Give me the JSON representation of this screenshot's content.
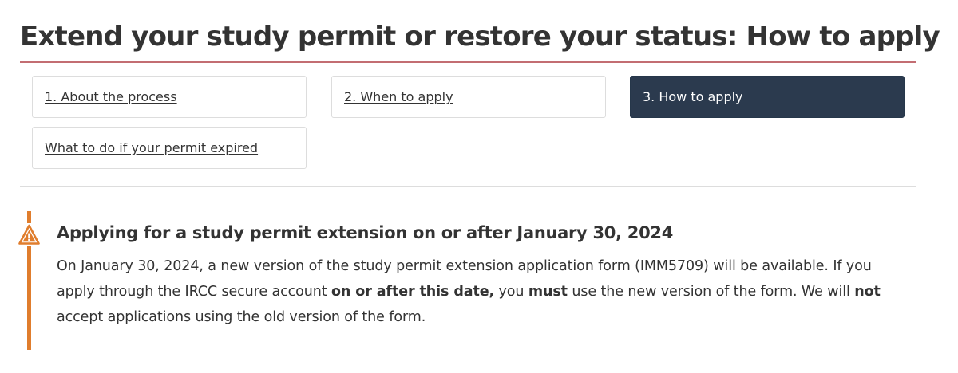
{
  "page": {
    "title": "Extend your study permit or restore your status: How to apply"
  },
  "steps": [
    {
      "label": "1. About the process",
      "active": false
    },
    {
      "label": "2. When to apply",
      "active": false
    },
    {
      "label": "3. How to apply",
      "active": true
    },
    {
      "label": "What to do if your permit expired",
      "active": false
    }
  ],
  "alert": {
    "type": "warning",
    "icon": "warning-triangle-icon",
    "accent_color": "#e07d2d",
    "heading": "Applying for a study permit extension on or after January 30, 2024",
    "body": {
      "line1": "On January 30, 2024, a new version of the study permit extension application form (IMM5709) will be available. If you",
      "line2_a": "apply through the IRCC secure account ",
      "line2_b": "on or after this date,",
      "line2_c": " you ",
      "line2_d": "must",
      "line2_e": " use the new version of the form. We will ",
      "line2_f": "not",
      "line3": "accept applications using the old version of the form."
    }
  }
}
